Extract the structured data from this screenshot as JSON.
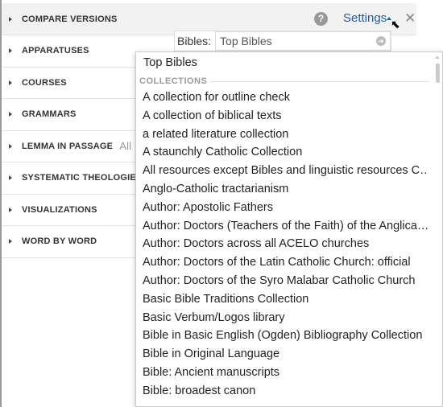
{
  "panels": [
    {
      "label": "COMPARE VERSIONS"
    },
    {
      "label": "APPARATUSES"
    },
    {
      "label": "COURSES"
    },
    {
      "label": "GRAMMARS"
    },
    {
      "label": "LEMMA IN PASSAGE",
      "sub": "All Co"
    },
    {
      "label": "SYSTEMATIC THEOLOGIES"
    },
    {
      "label": "VISUALIZATIONS"
    },
    {
      "label": "WORD BY WORD"
    }
  ],
  "header": {
    "help": "?",
    "settings": "Settings",
    "close": "✕"
  },
  "bibles": {
    "label": "Bibles:",
    "value": "Top Bibles"
  },
  "dropdown": {
    "top": "Top Bibles",
    "section": "COLLECTIONS",
    "items": [
      "A collection for outline check",
      "A collection of biblical texts",
      "a related literature collection",
      "A staunchly Catholic Collection",
      "All resources except Bibles and linguistic resources C…",
      "Anglo-Catholic tractarianism",
      "Author: Apostolic Fathers",
      "Author: Doctors (Teachers of the Faith) of the Anglica…",
      "Author: Doctors across all ACELO churches",
      "Author: Doctors of the Latin Catholic Church: official",
      "Author: Doctors of the Syro Malabar Catholic Church",
      "Basic Bible Traditions Collection",
      "Basic Verbum/Logos library",
      "Bible in Basic English (Ogden) Bibliography Collection",
      "Bible in Original Language",
      "Bible: Ancient manuscripts",
      "Bible: broadest canon"
    ]
  },
  "colors": {
    "link": "#2a5a9c"
  }
}
